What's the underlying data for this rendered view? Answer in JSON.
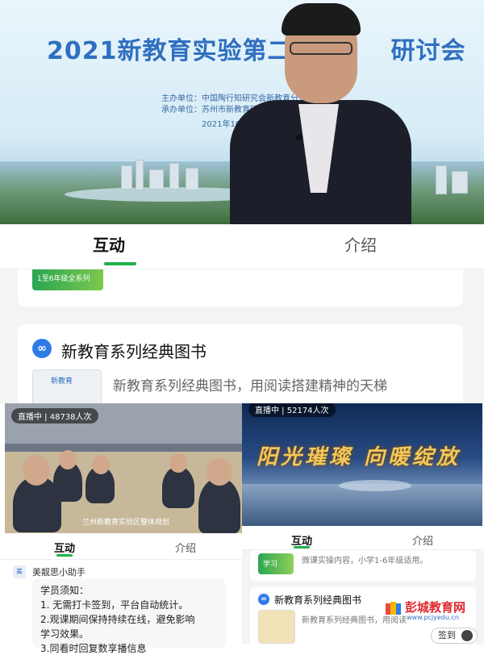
{
  "top_video": {
    "title": "2021新教育实验第二",
    "title_tail": "研讨会",
    "host_label": "主办单位：中国陶行知研究会新教育分会",
    "organizer_label": "承办单位：苏州市新教育研究院",
    "organizer_tail": "苏",
    "date": "2021年10月2"
  },
  "main_tabs": {
    "interact": "互动",
    "intro": "介绍"
  },
  "books_card": {
    "title": "新教育系列经典图书",
    "description": "新教育系列经典图书，用阅读搭建精神的天梯",
    "thumb_text": "新教育"
  },
  "top_card_thumb_text": "1至6年级全系列",
  "left_video": {
    "badge": "直播中 | 48738人次",
    "caption": "兰州新教育实验区整体规划"
  },
  "right_video": {
    "badge": "直播中 | 52174人次",
    "banner": "阳光璀璨 向暖绽放"
  },
  "left_tabs": {
    "interact": "互动",
    "intro": "介绍"
  },
  "right_tabs": {
    "interact": "互动",
    "intro": "介绍"
  },
  "chat": {
    "avatar_text": "美",
    "sender": "美靓思小助手",
    "lines": [
      "学员须知：",
      "1. 无需打卡签到，平台自动统计。",
      "2.观课期间保持持续在线，避免影响",
      "学习效果。",
      "3.同看时回复数享播信息"
    ]
  },
  "right_panel": {
    "top_thumb_text": "学习",
    "top_desc": "微课实操内容，小学1-6年级适用。",
    "books_title": "新教育系列经典图书",
    "books_desc": "新教育系列经典图书，用阅读",
    "signin": "签到"
  },
  "watermark": {
    "name": "彭城教育网",
    "url": "www.pcjyedu.cn"
  },
  "colors": {
    "accent_green": "#1fb24a",
    "link_blue": "#2f7ae5",
    "title_blue": "#2f6fc0"
  }
}
